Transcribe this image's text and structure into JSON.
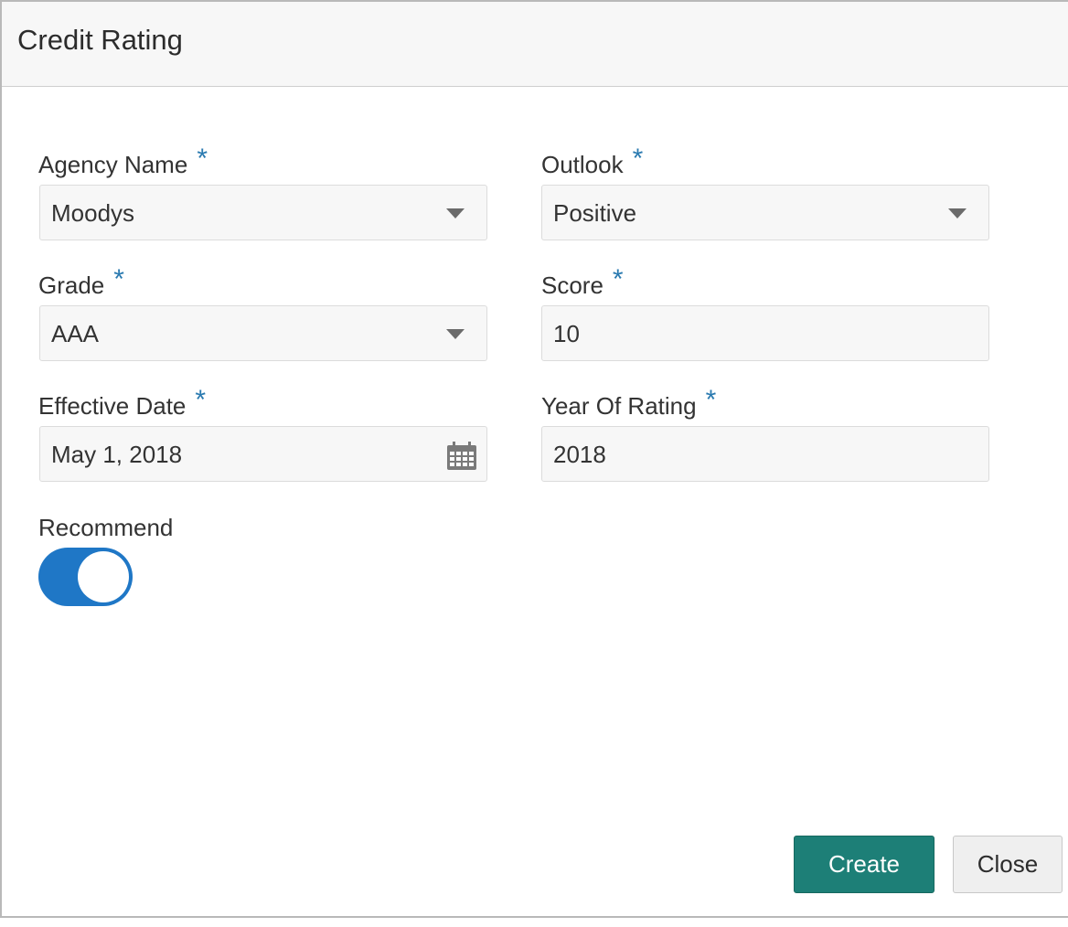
{
  "dialog": {
    "title": "Credit Rating"
  },
  "fields": {
    "agency_name": {
      "label": "Agency Name",
      "required_mark": "*",
      "value": "Moodys"
    },
    "outlook": {
      "label": "Outlook",
      "required_mark": "*",
      "value": "Positive"
    },
    "grade": {
      "label": "Grade",
      "required_mark": "*",
      "value": "AAA"
    },
    "score": {
      "label": "Score",
      "required_mark": "*",
      "value": "10"
    },
    "effective_date": {
      "label": "Effective Date",
      "required_mark": "*",
      "value": "May 1, 2018"
    },
    "year_of_rating": {
      "label": "Year Of Rating",
      "required_mark": "*",
      "value": "2018"
    },
    "recommend": {
      "label": "Recommend",
      "checked": true
    }
  },
  "buttons": {
    "create_label": "Create",
    "close_label": "Close"
  },
  "colors": {
    "required_mark": "#2a7ab0",
    "toggle_on": "#1f77c6",
    "create_button": "#1d7f77"
  }
}
